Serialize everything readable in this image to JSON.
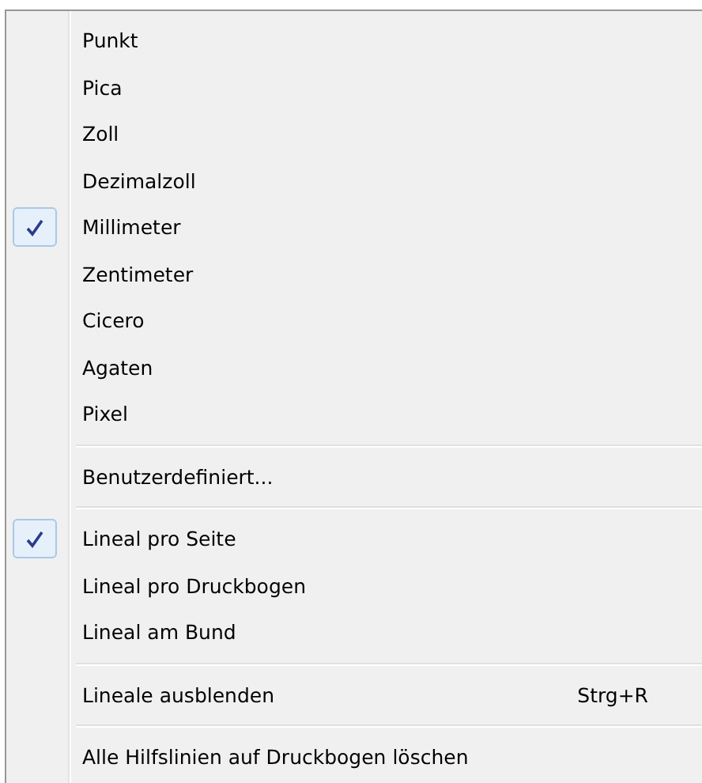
{
  "menu": {
    "groups": [
      {
        "items": [
          {
            "label": "Punkt",
            "checked": false
          },
          {
            "label": "Pica",
            "checked": false
          },
          {
            "label": "Zoll",
            "checked": false
          },
          {
            "label": "Dezimalzoll",
            "checked": false
          },
          {
            "label": "Millimeter",
            "checked": true
          },
          {
            "label": "Zentimeter",
            "checked": false
          },
          {
            "label": "Cicero",
            "checked": false
          },
          {
            "label": "Agaten",
            "checked": false
          },
          {
            "label": "Pixel",
            "checked": false
          }
        ]
      },
      {
        "items": [
          {
            "label": "Benutzerdefiniert...",
            "checked": false
          }
        ]
      },
      {
        "items": [
          {
            "label": "Lineal pro Seite",
            "checked": true
          },
          {
            "label": "Lineal pro Druckbogen",
            "checked": false
          },
          {
            "label": "Lineal am Bund",
            "checked": false
          }
        ]
      },
      {
        "items": [
          {
            "label": "Lineale ausblenden",
            "checked": false,
            "shortcut": "Strg+R"
          }
        ]
      },
      {
        "items": [
          {
            "label": "Alle Hilfslinien auf Druckbogen löschen",
            "checked": false
          }
        ]
      }
    ]
  }
}
